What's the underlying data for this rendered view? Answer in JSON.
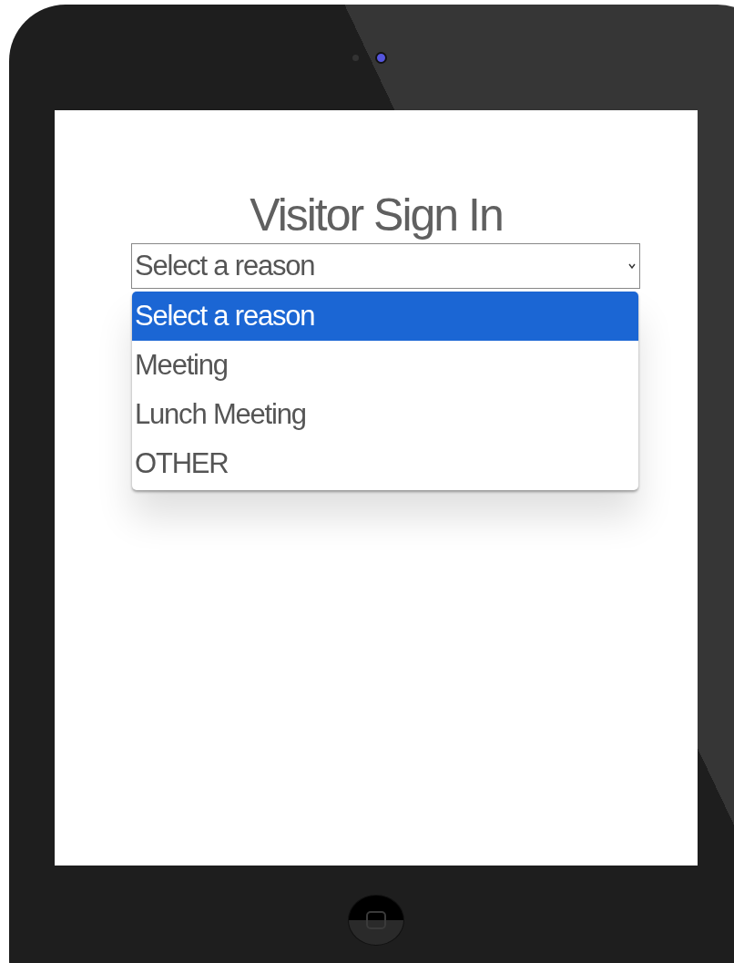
{
  "title": "Visitor Sign In",
  "reason_select": {
    "value": "Select a reason",
    "expanded": true
  },
  "options": [
    {
      "label": "Select a reason",
      "selected": true
    },
    {
      "label": "Meeting",
      "selected": false
    },
    {
      "label": "Lunch Meeting",
      "selected": false
    },
    {
      "label": "OTHER",
      "selected": false
    }
  ]
}
